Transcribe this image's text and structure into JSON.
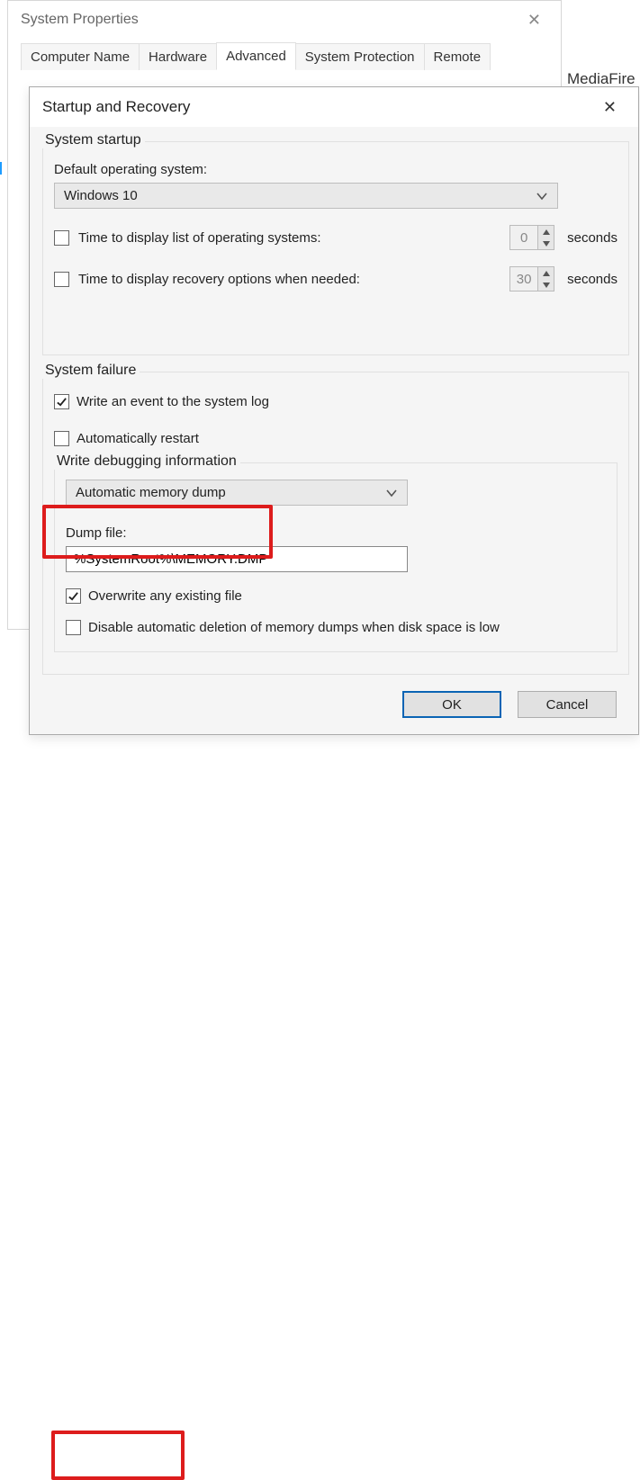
{
  "bgWindow": {
    "title": "System Properties",
    "tabs": [
      "Computer Name",
      "Hardware",
      "Advanced",
      "System Protection",
      "Remote"
    ],
    "activeTab": 2
  },
  "sideLabel": "MediaFire",
  "dialog": {
    "title": "Startup and Recovery"
  },
  "startup": {
    "groupTitle": "System startup",
    "defaultLabel": "Default operating system:",
    "defaultValue": "Windows 10",
    "timeListLabel": "Time to display list of operating systems:",
    "timeListChecked": false,
    "timeListValue": "0",
    "timeRecoveryLabel": "Time to display recovery options when needed:",
    "timeRecoveryChecked": false,
    "timeRecoveryValue": "30",
    "unit": "seconds"
  },
  "failure": {
    "groupTitle": "System failure",
    "writeEventLabel": "Write an event to the system log",
    "writeEventChecked": true,
    "autoRestartLabel": "Automatically restart",
    "autoRestartChecked": false,
    "debugGroupTitle": "Write debugging information",
    "dumpTypeValue": "Automatic memory dump",
    "dumpFileLabel": "Dump file:",
    "dumpFileValue": "%SystemRoot%\\MEMORY.DMP",
    "overwriteLabel": "Overwrite any existing file",
    "overwriteChecked": true,
    "disableDeleteLabel": "Disable automatic deletion of memory dumps when disk space is low",
    "disableDeleteChecked": false
  },
  "buttons": {
    "ok": "OK",
    "cancel": "Cancel"
  }
}
